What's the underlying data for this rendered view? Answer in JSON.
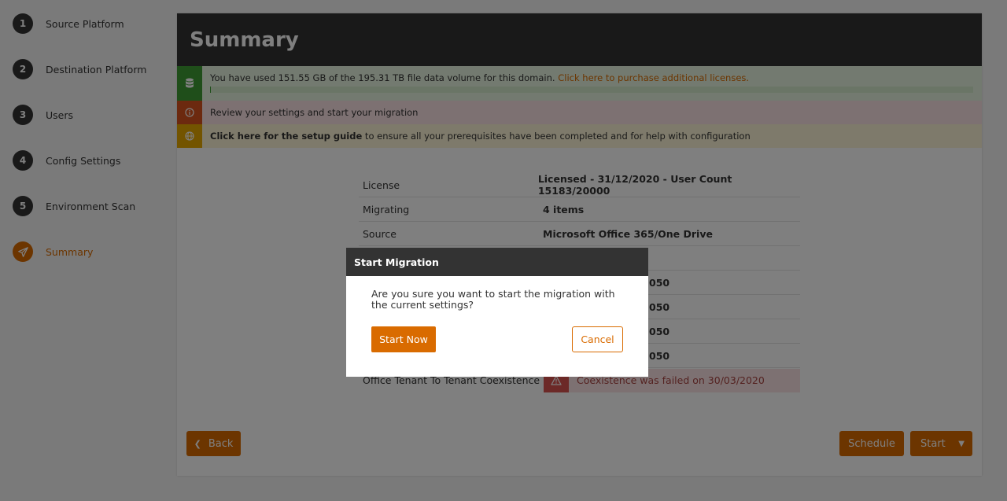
{
  "sidebar": {
    "steps": [
      {
        "num": "1",
        "label": "Source Platform"
      },
      {
        "num": "2",
        "label": "Destination Platform"
      },
      {
        "num": "3",
        "label": "Users"
      },
      {
        "num": "4",
        "label": "Config Settings"
      },
      {
        "num": "5",
        "label": "Environment Scan"
      },
      {
        "num": "",
        "label": "Summary",
        "icon": "paper-plane-icon",
        "active": true
      }
    ]
  },
  "header": {
    "title": "Summary"
  },
  "alerts": {
    "usage": {
      "icon": "database-icon",
      "text": "You have used 151.55 GB of the 195.31 TB file data volume for this domain. ",
      "link": "Click here to purchase additional licenses.",
      "progress": 0.0008
    },
    "review": {
      "icon": "info-icon",
      "text": "Review your settings and start your migration"
    },
    "guide": {
      "icon": "globe-icon",
      "link": "Click here for the setup guide",
      "text": " to ensure all your prerequisites have been completed and for help with configuration"
    }
  },
  "summary": {
    "rows": [
      {
        "key": "License",
        "value": "Licensed - 31/12/2020 - User Count 15183/20000"
      },
      {
        "key": "Migrating",
        "value": "4 items"
      },
      {
        "key": "Source",
        "value": "Microsoft Office 365/One Drive"
      },
      {
        "key": "",
        "value": ""
      },
      {
        "key": "",
        "value": "050"
      },
      {
        "key": "",
        "value": "050"
      },
      {
        "key": "",
        "value": "050"
      },
      {
        "key": "",
        "value": "050"
      }
    ],
    "coexistence": {
      "key": "Office Tenant To Tenant Coexistence",
      "value": "Coexistence was failed on 30/03/2020",
      "icon": "warning-icon"
    }
  },
  "footer": {
    "back": "Back",
    "schedule": "Schedule",
    "start": "Start"
  },
  "modal": {
    "title": "Start Migration",
    "message": "Are you sure you want to start the migration with the current settings?",
    "confirm": "Start Now",
    "cancel": "Cancel"
  },
  "colors": {
    "accent": "#d96b00",
    "dark": "#333333",
    "success": "#3f9c35",
    "danger": "#d9534f"
  }
}
